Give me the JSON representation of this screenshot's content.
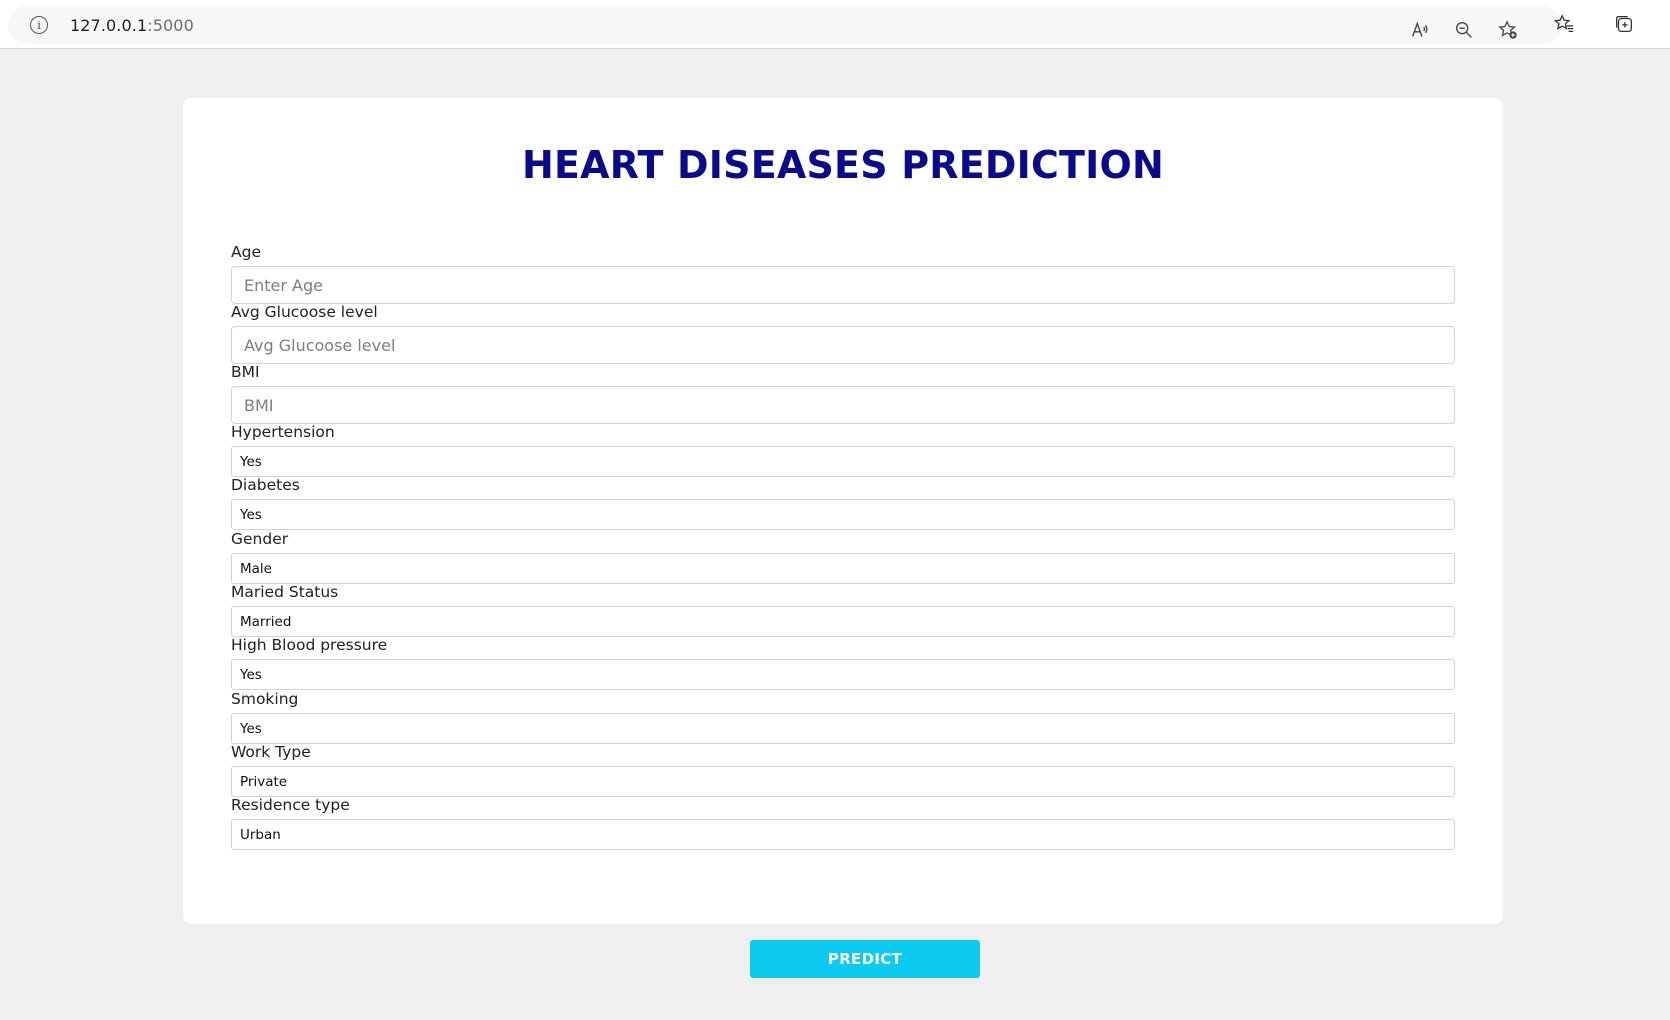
{
  "browser": {
    "url_host": "127.0.0.1",
    "url_port": ":5000"
  },
  "form": {
    "title": "HEART DISEASES PREDICTION",
    "fields": [
      {
        "label": "Age",
        "placeholder": "Enter Age",
        "value": ""
      },
      {
        "label": "Avg Glucoose level",
        "placeholder": "Avg Glucoose level",
        "value": ""
      },
      {
        "label": "BMI",
        "placeholder": "BMI",
        "value": ""
      }
    ],
    "selects": [
      {
        "label": "Hypertension",
        "value": "Yes"
      },
      {
        "label": "Diabetes",
        "value": "Yes"
      },
      {
        "label": "Gender",
        "value": "Male"
      },
      {
        "label": "Maried Status",
        "value": "Married"
      },
      {
        "label": "High Blood pressure",
        "value": "Yes"
      },
      {
        "label": "Smoking",
        "value": "Yes"
      },
      {
        "label": "Work Type",
        "value": "Private"
      },
      {
        "label": "Residence type",
        "value": "Urban"
      }
    ],
    "submit_label": "PREDICT"
  },
  "icons": {
    "address": "info-icon",
    "toolbar": [
      "read-aloud-icon",
      "zoom-out-icon",
      "add-favorite-icon",
      "favorites-icon",
      "collections-icon"
    ]
  },
  "colors": {
    "title": "#0a0a8a",
    "button": "#0dcaf0",
    "background": "#efefef"
  }
}
